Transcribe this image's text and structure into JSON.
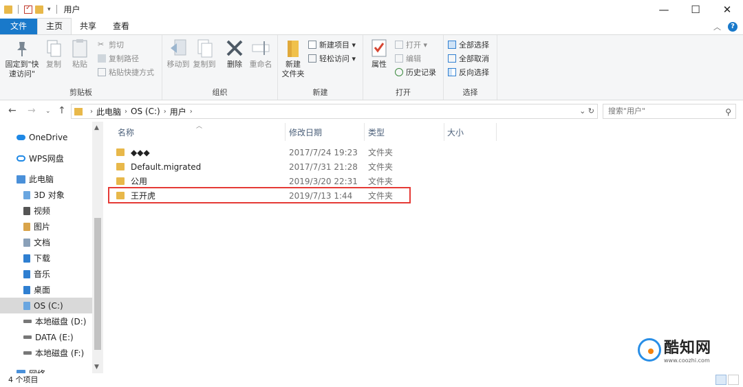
{
  "window": {
    "title": "用户",
    "minimize": "—",
    "maximize": "☐",
    "close": "✕"
  },
  "tabs": [
    "文件",
    "主页",
    "共享",
    "查看"
  ],
  "ribbon": {
    "clipboard": {
      "label": "剪贴板",
      "pin": "固定到\"快速访问\"",
      "copy": "复制",
      "paste": "粘贴",
      "cut": "剪切",
      "copy_path": "复制路径",
      "paste_shortcut": "粘贴快捷方式"
    },
    "organize": {
      "label": "组织",
      "move_to": "移动到",
      "copy_to": "复制到",
      "delete": "删除",
      "rename": "重命名"
    },
    "new": {
      "label": "新建",
      "new_folder": "新建\n文件夹",
      "new_item": "新建项目 ▾",
      "easy_access": "轻松访问 ▾"
    },
    "open": {
      "label": "打开",
      "properties": "属性",
      "open": "打开 ▾",
      "edit": "编辑",
      "history": "历史记录"
    },
    "select": {
      "label": "选择",
      "select_all": "全部选择",
      "select_none": "全部取消",
      "invert": "反向选择"
    }
  },
  "address": {
    "crumbs": [
      "此电脑",
      "OS (C:)",
      "用户"
    ],
    "search_placeholder": "搜索\"用户\""
  },
  "nav": {
    "items": [
      {
        "label": "OneDrive",
        "icon": "cloud-icon",
        "color": "#1e88e5"
      },
      {
        "label": "WPS网盘",
        "icon": "cloud-outline-icon",
        "color": "#1e88e5"
      },
      {
        "label": "此电脑",
        "icon": "computer-icon",
        "color": "#4a90d9"
      },
      {
        "label": "3D 对象",
        "icon": "3d-objects-icon",
        "color": "#6aa6e0"
      },
      {
        "label": "视频",
        "icon": "video-icon",
        "color": "#555555"
      },
      {
        "label": "图片",
        "icon": "pictures-icon",
        "color": "#d9a44a"
      },
      {
        "label": "文档",
        "icon": "documents-icon",
        "color": "#8aa0b8"
      },
      {
        "label": "下载",
        "icon": "download-icon",
        "color": "#2f7fd1"
      },
      {
        "label": "音乐",
        "icon": "music-icon",
        "color": "#2f7fd1"
      },
      {
        "label": "桌面",
        "icon": "desktop-icon",
        "color": "#2f7fd1"
      },
      {
        "label": "OS (C:)",
        "icon": "os-drive-icon",
        "color": "#6aa6e0"
      },
      {
        "label": "本地磁盘 (D:)",
        "icon": "drive-icon",
        "color": "#777777"
      },
      {
        "label": "DATA (E:)",
        "icon": "drive-icon",
        "color": "#777777"
      },
      {
        "label": "本地磁盘 (F:)",
        "icon": "drive-icon",
        "color": "#777777"
      },
      {
        "label": "网络",
        "icon": "network-icon",
        "color": "#4a90d9"
      }
    ]
  },
  "list": {
    "columns": [
      "名称",
      "修改日期",
      "类型",
      "大小"
    ],
    "rows": [
      {
        "name": "◆◆◆",
        "date": "2017/7/24 19:23",
        "type": "文件夹"
      },
      {
        "name": "Default.migrated",
        "date": "2017/7/31 21:28",
        "type": "文件夹"
      },
      {
        "name": "公用",
        "date": "2019/3/20 22:31",
        "type": "文件夹"
      },
      {
        "name": "王开虎",
        "date": "2019/7/13 1:44",
        "type": "文件夹"
      }
    ]
  },
  "status": {
    "count": "4 个项目"
  },
  "watermark": {
    "title": "酷知网",
    "url": "www.coozhi.com"
  },
  "colors": {
    "accent": "#1979ca",
    "highlight": "#e53935",
    "folder": "#e8b84a"
  }
}
